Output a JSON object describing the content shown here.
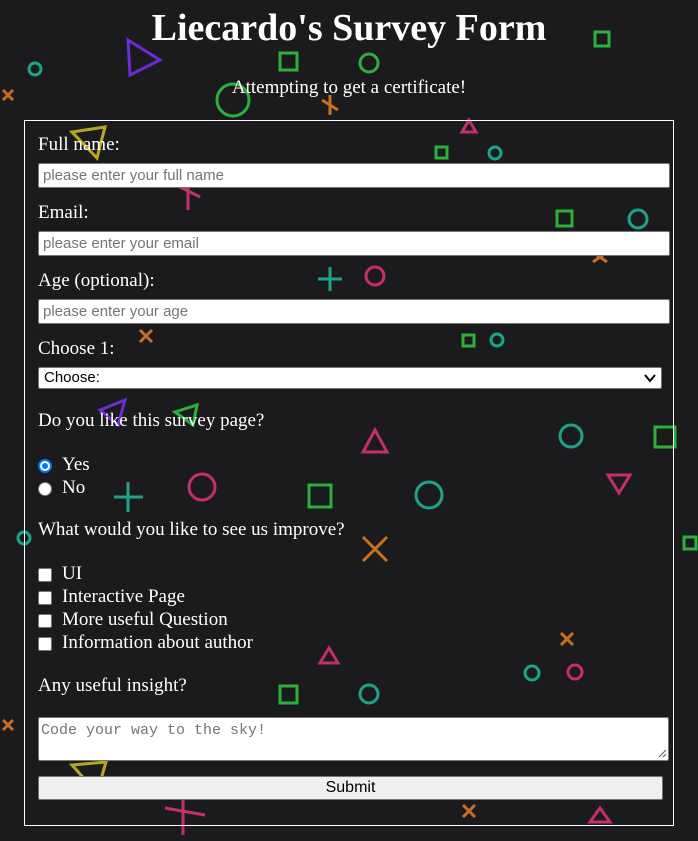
{
  "page": {
    "title": "Liecardo's Survey Form",
    "description": "Attempting to get a certificate!"
  },
  "form": {
    "name": {
      "label": "Full name:",
      "placeholder": "please enter your full name"
    },
    "email": {
      "label": "Email:",
      "placeholder": "please enter your email"
    },
    "age": {
      "label": "Age (optional):",
      "placeholder": "please enter your age"
    },
    "dropdown": {
      "label": "Choose 1:",
      "selected": "Choose:"
    },
    "like": {
      "question": "Do you like this survey page?",
      "options": [
        {
          "label": "Yes",
          "checked": true
        },
        {
          "label": "No",
          "checked": false
        }
      ]
    },
    "improve": {
      "question": "What would you like to see us improve?",
      "options": [
        {
          "label": "UI",
          "checked": false
        },
        {
          "label": "Interactive Page",
          "checked": false
        },
        {
          "label": "More useful Question",
          "checked": false
        },
        {
          "label": "Information about author",
          "checked": false
        }
      ]
    },
    "insight": {
      "label": "Any useful insight?",
      "placeholder": "Code your way to the sky!"
    },
    "submit_label": "Submit"
  },
  "colors": {
    "background": "#1b1b1e",
    "radio_accent": "#0075ff",
    "shape_green": "#2ecc40",
    "shape_teal": "#1abc9c",
    "shape_pink": "#e0337a",
    "shape_purple": "#7b2ff7",
    "shape_orange": "#e67e22",
    "shape_yellow": "#d4c21a"
  }
}
